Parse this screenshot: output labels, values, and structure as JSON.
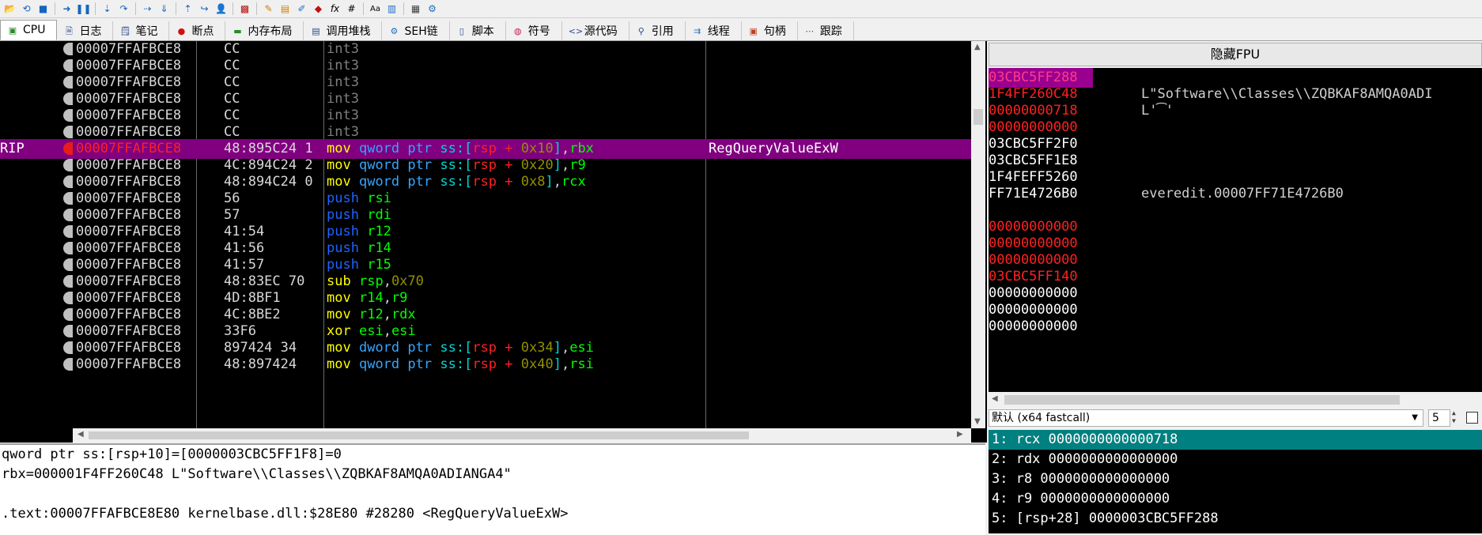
{
  "toolbar": {
    "icons": [
      "open-icon",
      "restart-icon",
      "stop-icon",
      "run-icon",
      "pause-icon",
      "step-into-icon",
      "step-over-icon",
      "trace-into-icon",
      "trace-over-icon",
      "execute-till-return-icon",
      "run-to-user-code-icon",
      "script-icon",
      "patch-icon",
      "comment-icon",
      "label-icon",
      "bookmark-icon",
      "function-icon",
      "hash-icon",
      "font-icon",
      "text-icon",
      "calculator-icon",
      "settings-icon"
    ],
    "fx_label": "fx",
    "hash_label": "#"
  },
  "tabs": [
    {
      "label": "CPU",
      "icon": "cpu-icon",
      "active": true
    },
    {
      "label": "日志",
      "icon": "log-icon"
    },
    {
      "label": "笔记",
      "icon": "notes-icon"
    },
    {
      "label": "断点",
      "icon": "breakpoint-icon"
    },
    {
      "label": "内存布局",
      "icon": "memory-map-icon"
    },
    {
      "label": "调用堆栈",
      "icon": "call-stack-icon"
    },
    {
      "label": "SEH链",
      "icon": "seh-icon"
    },
    {
      "label": "脚本",
      "icon": "script-icon"
    },
    {
      "label": "符号",
      "icon": "symbols-icon"
    },
    {
      "label": "源代码",
      "icon": "source-icon"
    },
    {
      "label": "引用",
      "icon": "references-icon"
    },
    {
      "label": "线程",
      "icon": "threads-icon"
    },
    {
      "label": "句柄",
      "icon": "handles-icon"
    },
    {
      "label": "跟踪",
      "icon": "trace-icon"
    }
  ],
  "disasm": {
    "rows": [
      {
        "label": "",
        "addr": "00007FFAFBCE8",
        "bytes": "CC",
        "comment": "",
        "bp": false,
        "sel": false
      },
      {
        "label": "",
        "addr": "00007FFAFBCE8",
        "bytes": "CC",
        "comment": "",
        "bp": false,
        "sel": false
      },
      {
        "label": "",
        "addr": "00007FFAFBCE8",
        "bytes": "CC",
        "comment": "",
        "bp": false,
        "sel": false
      },
      {
        "label": "",
        "addr": "00007FFAFBCE8",
        "bytes": "CC",
        "comment": "",
        "bp": false,
        "sel": false
      },
      {
        "label": "",
        "addr": "00007FFAFBCE8",
        "bytes": "CC",
        "comment": "",
        "bp": false,
        "sel": false
      },
      {
        "label": "",
        "addr": "00007FFAFBCE8",
        "bytes": "CC",
        "comment": "",
        "bp": false,
        "sel": false
      },
      {
        "label": "RIP",
        "addr": "00007FFAFBCE8",
        "bytes": "48:895C24 1",
        "comment": "RegQueryValueExW",
        "bp": true,
        "sel": true
      },
      {
        "label": "",
        "addr": "00007FFAFBCE8",
        "bytes": "4C:894C24 2",
        "comment": "",
        "bp": false,
        "sel": false
      },
      {
        "label": "",
        "addr": "00007FFAFBCE8",
        "bytes": "48:894C24 0",
        "comment": "",
        "bp": false,
        "sel": false
      },
      {
        "label": "",
        "addr": "00007FFAFBCE8",
        "bytes": "56",
        "comment": "",
        "bp": false,
        "sel": false
      },
      {
        "label": "",
        "addr": "00007FFAFBCE8",
        "bytes": "57",
        "comment": "",
        "bp": false,
        "sel": false
      },
      {
        "label": "",
        "addr": "00007FFAFBCE8",
        "bytes": "41:54",
        "comment": "",
        "bp": false,
        "sel": false
      },
      {
        "label": "",
        "addr": "00007FFAFBCE8",
        "bytes": "41:56",
        "comment": "",
        "bp": false,
        "sel": false
      },
      {
        "label": "",
        "addr": "00007FFAFBCE8",
        "bytes": "41:57",
        "comment": "",
        "bp": false,
        "sel": false
      },
      {
        "label": "",
        "addr": "00007FFAFBCE8",
        "bytes": "48:83EC 70",
        "comment": "",
        "bp": false,
        "sel": false
      },
      {
        "label": "",
        "addr": "00007FFAFBCE8",
        "bytes": "4D:8BF1",
        "comment": "",
        "bp": false,
        "sel": false
      },
      {
        "label": "",
        "addr": "00007FFAFBCE8",
        "bytes": "4C:8BE2",
        "comment": "",
        "bp": false,
        "sel": false
      },
      {
        "label": "",
        "addr": "00007FFAFBCE8",
        "bytes": "33F6",
        "comment": "",
        "bp": false,
        "sel": false
      },
      {
        "label": "",
        "addr": "00007FFAFBCE8",
        "bytes": "897424 34",
        "comment": "",
        "bp": false,
        "sel": false
      },
      {
        "label": "",
        "addr": "00007FFAFBCE8",
        "bytes": "48:897424",
        "comment": "",
        "bp": false,
        "sel": false
      }
    ],
    "instr": {
      "int3": "int3",
      "mov": "mov",
      "push": "push",
      "sub": "sub",
      "xor": "xor",
      "qword_ptr": "qword ptr",
      "dword_ptr": "dword ptr",
      "ss": "ss:",
      "lb": "[",
      "rb": "]",
      "plus": " + ",
      "comma": ",",
      "rsp": "rsp",
      "rbx": "rbx",
      "r9": "r9",
      "rcx": "rcx",
      "rsi": "rsi",
      "rdi": "rdi",
      "r12": "r12",
      "r14": "r14",
      "r15": "r15",
      "rdx": "rdx",
      "esi": "esi",
      "n10": "0x10",
      "n20": "0x20",
      "n8": "0x8",
      "n70": "0x70",
      "n34": "0x34",
      "n40": "0x40"
    }
  },
  "info": {
    "lines": [
      "qword ptr ss:[rsp+10]=[0000003CBC5FF1F8]=0",
      "rbx=000001F4FF260C48 L\"Software\\\\Classes\\\\ZQBKAF8AMQA0ADIANGA4\"",
      "",
      ".text:00007FFAFBCE8E80 kernelbase.dll:$28E80 #28280 <RegQueryValueExW>"
    ]
  },
  "fpu": {
    "header": "隐藏FPU",
    "rows": [
      {
        "value": "03CBC5FF288",
        "comment": "",
        "style": "hl"
      },
      {
        "value": "1F4FF260C48",
        "comment": "L\"Software\\\\Classes\\\\ZQBKAF8AMQA0ADI",
        "style": "red"
      },
      {
        "value": "00000000718",
        "comment": "L'͡'",
        "style": "red"
      },
      {
        "value": "00000000000",
        "comment": "",
        "style": "red"
      },
      {
        "value": "03CBC5FF2F0",
        "comment": "",
        "style": "wht"
      },
      {
        "value": "03CBC5FF1E8",
        "comment": "",
        "style": "wht"
      },
      {
        "value": "1F4FEFF5260",
        "comment": "",
        "style": "wht"
      },
      {
        "value": "FF71E4726B0",
        "comment": "everedit.00007FF71E4726B0",
        "style": "wht"
      },
      {
        "value": "",
        "comment": "",
        "style": "wht"
      },
      {
        "value": "00000000000",
        "comment": "",
        "style": "red"
      },
      {
        "value": "00000000000",
        "comment": "",
        "style": "red"
      },
      {
        "value": "00000000000",
        "comment": "",
        "style": "red"
      },
      {
        "value": "03CBC5FF140",
        "comment": "",
        "style": "red"
      },
      {
        "value": "00000000000",
        "comment": "",
        "style": "wht"
      },
      {
        "value": "00000000000",
        "comment": "",
        "style": "wht"
      },
      {
        "value": "00000000000",
        "comment": "",
        "style": "wht"
      }
    ]
  },
  "callconv": {
    "selected": "默认 (x64 fastcall)",
    "count": "5",
    "args": [
      "1: rcx 0000000000000718",
      "2: rdx 0000000000000000",
      "3: r8 0000000000000000",
      "4: r9 0000000000000000",
      "5: [rsp+28] 0000003CBC5FF288"
    ]
  },
  "colors": {
    "selection": "#800080",
    "breakpoint": "#e81c1c",
    "arg_selection": "#008080"
  }
}
